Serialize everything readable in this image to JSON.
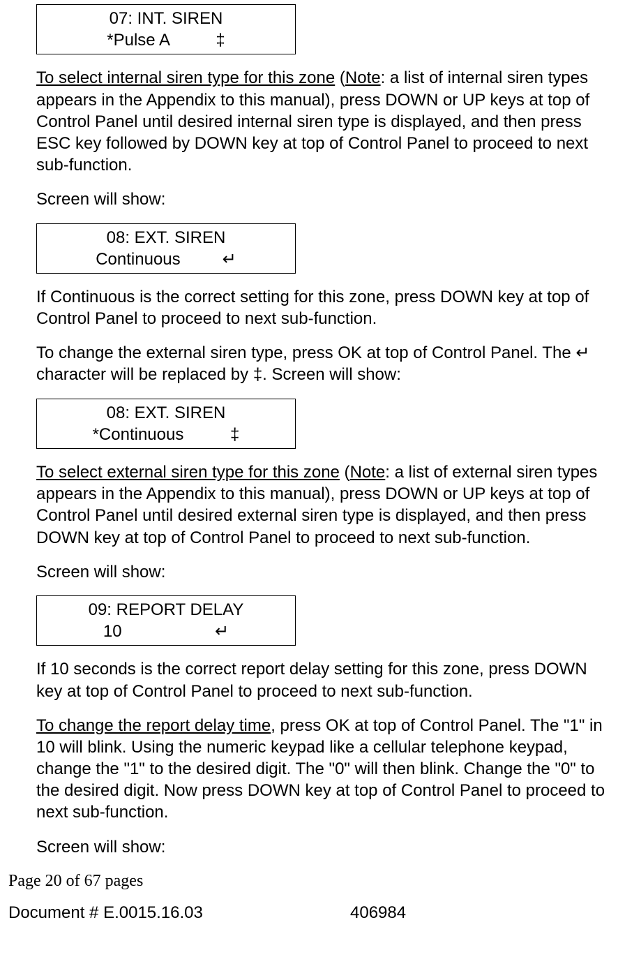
{
  "screen1": {
    "line1": "07: INT. SIREN",
    "line2": "*Pulse A          ‡"
  },
  "para1": {
    "u1": "To select internal siren type for this zone",
    "t1": " (",
    "u2": "Note",
    "t2": ": a list of internal siren types appears in the Appendix to this manual), press DOWN or UP keys at top of Control Panel until desired internal siren type is displayed, and then press ESC key followed by DOWN key at top of Control Panel to proceed to next sub-function."
  },
  "para2": "Screen will show:",
  "screen2": {
    "line1": "08: EXT. SIREN",
    "line2": "Continuous         ↵"
  },
  "para3": "If Continuous is the correct setting for this zone, press DOWN key at top of Control Panel to proceed to next sub-function.",
  "para4": "To change the external siren type, press OK at top of Control Panel. The ↵ character will be replaced by ‡. Screen will show:",
  "screen3": {
    "line1": "08: EXT. SIREN",
    "line2": "*Continuous          ‡"
  },
  "para5": {
    "u1": "To select external siren type for this zone",
    "t1": " (",
    "u2": "Note",
    "t2": ": a list of external siren types appears in the Appendix to this manual), press DOWN or UP keys at top of Control Panel until desired external siren type is displayed, and then press DOWN key at top of Control Panel to proceed to next sub-function."
  },
  "para6": "Screen will show:",
  "screen4": {
    "line1": "09: REPORT DELAY",
    "line2": "10                    ↵"
  },
  "para7": "If 10 seconds is the correct report delay setting for this zone, press DOWN key at top of Control Panel to proceed to next sub-function.",
  "para8": {
    "u1": "To change the report delay time",
    "t1": ", press OK at top of Control Panel. The \"1\" in 10 will blink. Using the numeric keypad like a cellular telephone keypad, change the \"1\" to the desired digit. The \"0\" will then blink. Change the \"0\" to the desired digit. Now press DOWN key at top of Control Panel to proceed to next sub-function."
  },
  "para9": "Screen will show:",
  "footer": {
    "page_info": "Page 20 of  67 pages",
    "doc_num": "Document # E.0015.16.03",
    "code": "406984"
  }
}
